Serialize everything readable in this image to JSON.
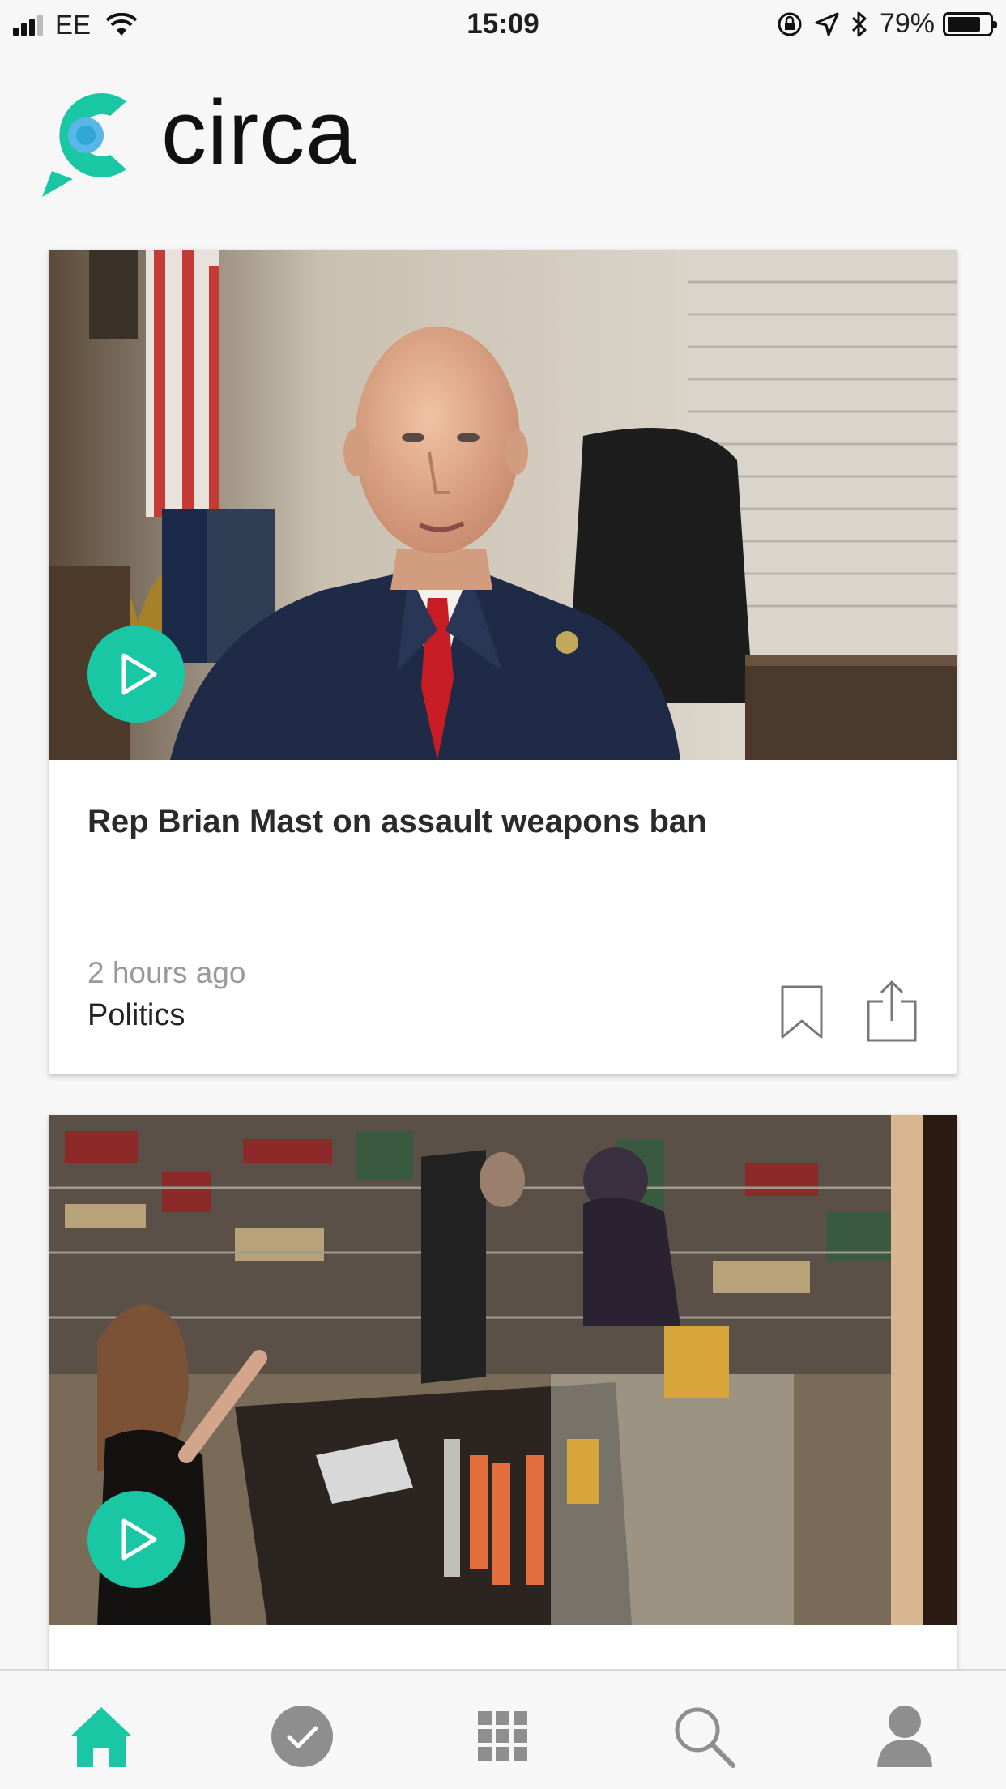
{
  "status_bar": {
    "carrier": "EE",
    "time": "15:09",
    "battery_percent": "79%",
    "battery_level": 0.79,
    "icons": [
      "signal-icon",
      "wifi-icon",
      "orientation-lock-icon",
      "location-icon",
      "bluetooth-icon",
      "battery-icon"
    ]
  },
  "brand": {
    "name": "circa",
    "accent_color": "#1ac7a5"
  },
  "feed": {
    "items": [
      {
        "title": "Rep Brian Mast on assault weapons ban",
        "time": "2 hours ago",
        "category": "Politics",
        "media_icon": "play-icon"
      },
      {
        "media_icon": "play-icon"
      }
    ]
  },
  "tabbar": {
    "active": "home",
    "tabs": [
      {
        "icon": "home-icon"
      },
      {
        "icon": "check-circle-icon"
      },
      {
        "icon": "grid-icon"
      },
      {
        "icon": "search-icon"
      },
      {
        "icon": "profile-icon"
      }
    ]
  }
}
